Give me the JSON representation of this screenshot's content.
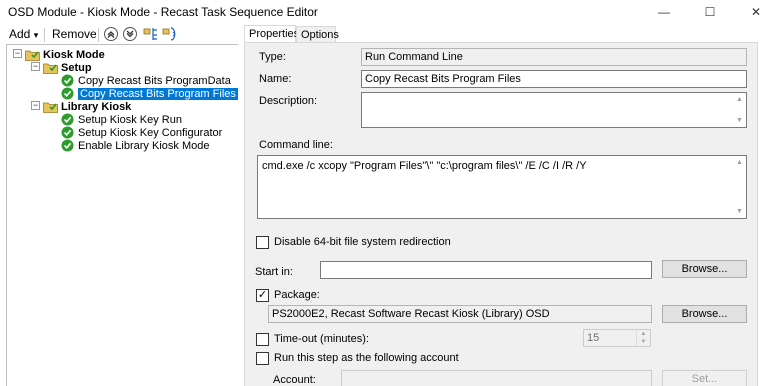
{
  "window": {
    "title": "OSD Module - Kiosk Mode - Recast Task Sequence Editor",
    "minimize_glyph": "—",
    "maximize_glyph": "☐",
    "close_glyph": "✕"
  },
  "toolbar": {
    "add_label": "Add",
    "add_caret": "▾",
    "remove_label": "Remove",
    "icons": [
      "move-up-icon",
      "move-down-icon",
      "collapse-icon",
      "expand-icon"
    ]
  },
  "tree": {
    "root": {
      "label": "Kiosk Mode",
      "expander": "−"
    },
    "groups": [
      {
        "label": "Setup",
        "expander": "−",
        "steps": [
          {
            "label": "Copy Recast Bits ProgramData",
            "selected": false
          },
          {
            "label": "Copy Recast Bits Program Files",
            "selected": true
          }
        ]
      },
      {
        "label": "Library Kiosk",
        "expander": "−",
        "steps": [
          {
            "label": "Setup Kiosk Key Run",
            "selected": false
          },
          {
            "label": "Setup Kiosk Key Configurator",
            "selected": false
          },
          {
            "label": "Enable Library Kiosk Mode",
            "selected": false
          }
        ]
      }
    ]
  },
  "tabs": [
    {
      "label": "Properties",
      "active": true
    },
    {
      "label": "Options",
      "active": false
    }
  ],
  "properties": {
    "type_label": "Type:",
    "type_value": "Run Command Line",
    "name_label": "Name:",
    "name_value": "Copy Recast Bits Program Files",
    "description_label": "Description:",
    "description_value": "",
    "command_line_label": "Command line:",
    "command_line_value": "cmd.exe /c xcopy \"Program Files\"\\\" \"c:\\program files\\\" /E /C /I /R /Y",
    "disable_redirection_label": "Disable 64-bit file system redirection",
    "disable_redirection_checked": false,
    "start_in_label": "Start in:",
    "start_in_value": "",
    "browse_label": "Browse...",
    "package_label": "Package:",
    "package_checked": true,
    "package_value": "PS2000E2, Recast Software Recast Kiosk (Library) OSD",
    "package_browse_label": "Browse...",
    "timeout_label": "Time-out (minutes):",
    "timeout_checked": false,
    "timeout_value": "15",
    "run_as_label": "Run this step as the following account",
    "run_as_checked": false,
    "account_label": "Account:",
    "account_value": "",
    "set_label": "Set..."
  },
  "colors": {
    "selection": "#0078d7",
    "check_green": "#2e9b2e",
    "folder_yellow": "#e8c25a"
  }
}
